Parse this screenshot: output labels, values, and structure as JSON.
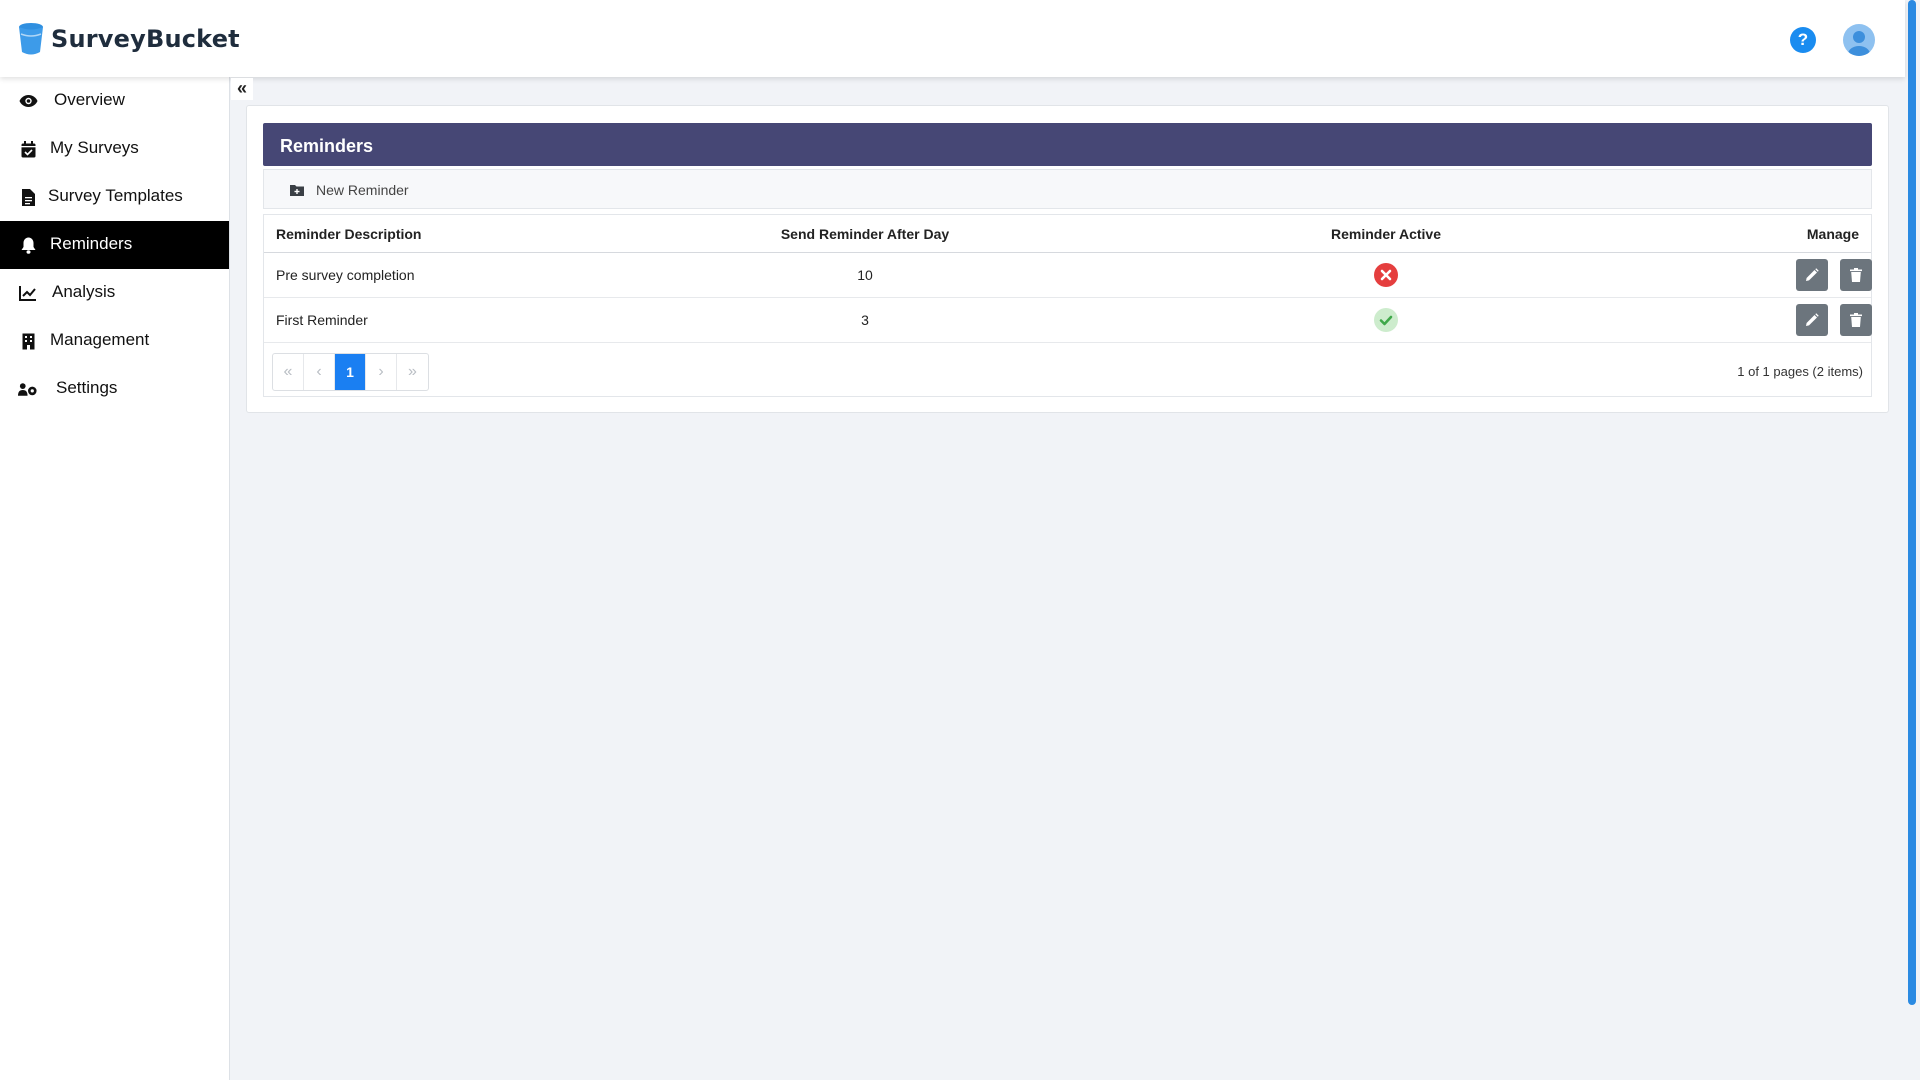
{
  "app": {
    "brand": "SurveyBucket",
    "help_label": "?"
  },
  "sidebar": {
    "items": [
      {
        "label": "Overview",
        "icon": "eye-icon"
      },
      {
        "label": "My Surveys",
        "icon": "calendar-check-icon"
      },
      {
        "label": "Survey Templates",
        "icon": "file-icon"
      },
      {
        "label": "Reminders",
        "icon": "bell-icon",
        "active": true
      },
      {
        "label": "Analysis",
        "icon": "chart-line-icon"
      },
      {
        "label": "Management",
        "icon": "building-icon"
      },
      {
        "label": "Settings",
        "icon": "users-cog-icon"
      }
    ]
  },
  "panel": {
    "title": "Reminders",
    "new_label": "New Reminder"
  },
  "table": {
    "columns": [
      "Reminder Description",
      "Send Reminder After Day",
      "Reminder Active",
      "Manage"
    ],
    "rows": [
      {
        "description": "Pre survey completion",
        "days": "10",
        "active": false
      },
      {
        "description": "First Reminder",
        "days": "3",
        "active": true
      }
    ]
  },
  "pager": {
    "first": "«",
    "prev": "‹",
    "current": "1",
    "next": "›",
    "last": "»",
    "info": "1 of 1 pages (2 items)"
  },
  "colors": {
    "header": "#464775",
    "active_nav": "#000000",
    "page_current": "#1a7ff2",
    "danger": "#e53e3e",
    "success": "#3fa84a"
  }
}
